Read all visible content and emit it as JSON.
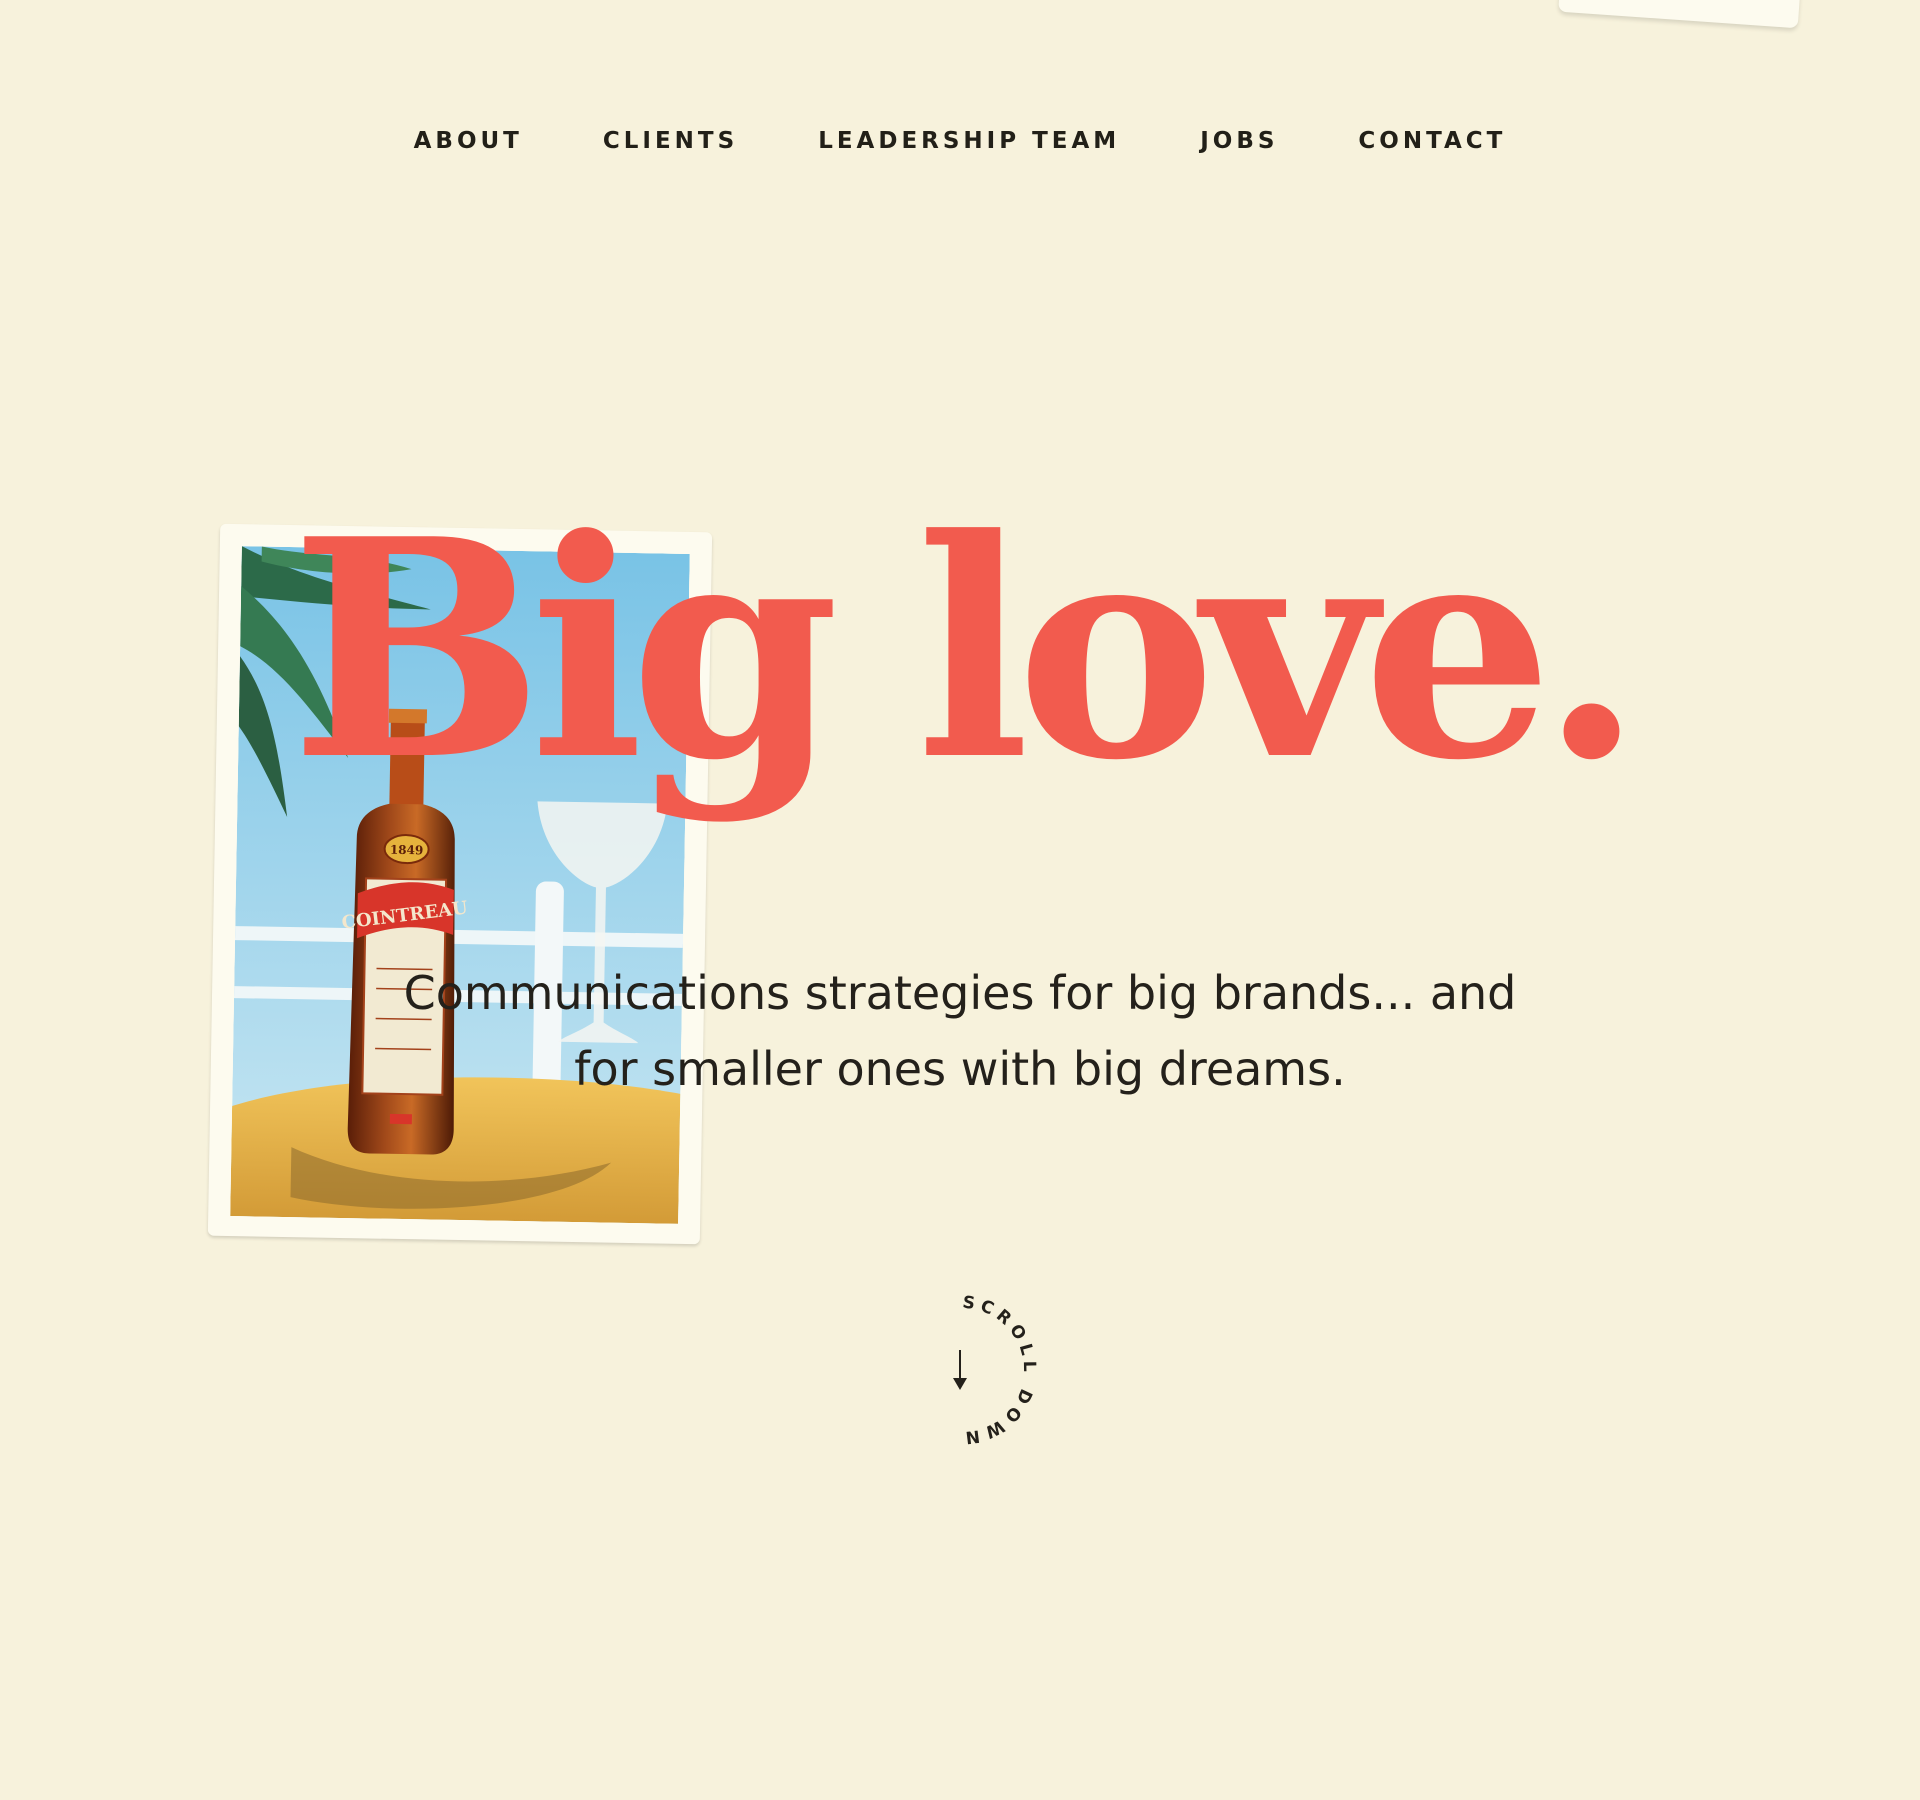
{
  "nav": {
    "items": [
      {
        "label": "ABOUT"
      },
      {
        "label": "CLIENTS"
      },
      {
        "label": "LEADERSHIP TEAM"
      },
      {
        "label": "JOBS"
      },
      {
        "label": "CONTACT"
      }
    ]
  },
  "hero": {
    "headline": "Big love.",
    "tagline_line1": "Communications strategies for big brands... and",
    "tagline_line2": "for smaller ones with big dreams."
  },
  "photo": {
    "brand_label": "COINTREAU",
    "year": "1849"
  },
  "scroll_indicator": {
    "label": "SCROLL DOWN",
    "icon": "arrow-down-icon"
  },
  "colors": {
    "background": "#f7f2dc",
    "accent": "#f25b4e",
    "text": "#24211b"
  }
}
